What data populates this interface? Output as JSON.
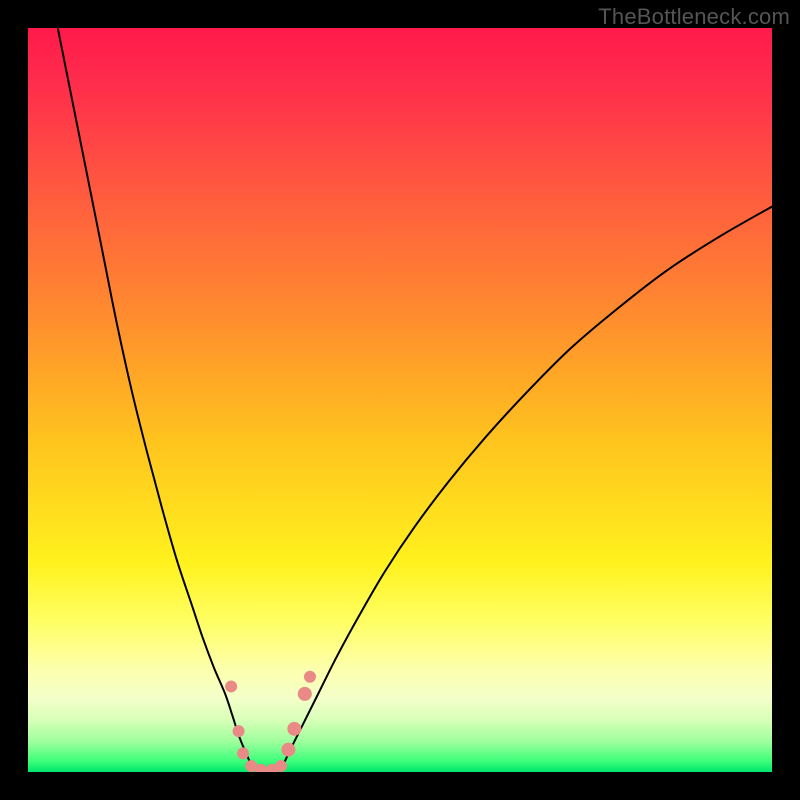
{
  "watermark": "TheBottleneck.com",
  "chart_data": {
    "type": "line",
    "title": "",
    "xlabel": "",
    "ylabel": "",
    "xlim": [
      0,
      100
    ],
    "ylim": [
      0,
      100
    ],
    "background_gradient": {
      "stops": [
        {
          "offset": 0.0,
          "color": "#ff1a4b"
        },
        {
          "offset": 0.08,
          "color": "#ff2e4b"
        },
        {
          "offset": 0.22,
          "color": "#ff5a3f"
        },
        {
          "offset": 0.38,
          "color": "#ff8a2f"
        },
        {
          "offset": 0.55,
          "color": "#ffc21e"
        },
        {
          "offset": 0.72,
          "color": "#fff21e"
        },
        {
          "offset": 0.8,
          "color": "#ffff66"
        },
        {
          "offset": 0.86,
          "color": "#fdffab"
        },
        {
          "offset": 0.9,
          "color": "#f4ffc9"
        },
        {
          "offset": 0.93,
          "color": "#d8ffb8"
        },
        {
          "offset": 0.96,
          "color": "#9cff9c"
        },
        {
          "offset": 0.985,
          "color": "#3eff7a"
        },
        {
          "offset": 1.0,
          "color": "#00e66b"
        }
      ]
    },
    "series": [
      {
        "name": "left-branch",
        "x": [
          4,
          6,
          8,
          10,
          12,
          14,
          16,
          18,
          20,
          22,
          23.5,
          25,
          26.5,
          27.5,
          28.3,
          29.1,
          29.8
        ],
        "y": [
          100,
          90,
          80,
          70,
          60,
          51,
          43,
          35.5,
          28.5,
          22.5,
          18,
          14,
          10.5,
          7.5,
          5,
          3,
          1.4
        ]
      },
      {
        "name": "right-branch",
        "x": [
          34.5,
          35.5,
          37,
          39,
          41.5,
          44.5,
          48,
          52,
          56.5,
          61.5,
          67,
          73,
          79.5,
          86,
          93,
          100
        ],
        "y": [
          1.4,
          3.5,
          6.5,
          10.5,
          15.5,
          21,
          27,
          33,
          39,
          45,
          51,
          57,
          62.5,
          67.5,
          72,
          76
        ]
      },
      {
        "name": "valley-floor",
        "x": [
          29.8,
          30.6,
          31.6,
          32.6,
          33.6,
          34.5
        ],
        "y": [
          1.4,
          0.6,
          0.3,
          0.3,
          0.6,
          1.4
        ]
      }
    ],
    "markers": {
      "name": "highlight-points",
      "color": "#e98a86",
      "points": [
        {
          "x": 27.3,
          "y": 11.5,
          "r": 6
        },
        {
          "x": 28.3,
          "y": 5.5,
          "r": 6
        },
        {
          "x": 28.9,
          "y": 2.5,
          "r": 6
        },
        {
          "x": 30.0,
          "y": 0.8,
          "r": 6
        },
        {
          "x": 31.3,
          "y": 0.3,
          "r": 6
        },
        {
          "x": 32.8,
          "y": 0.3,
          "r": 6
        },
        {
          "x": 34.0,
          "y": 0.8,
          "r": 6
        },
        {
          "x": 35.0,
          "y": 3.0,
          "r": 7
        },
        {
          "x": 35.8,
          "y": 5.8,
          "r": 7
        },
        {
          "x": 37.2,
          "y": 10.5,
          "r": 7
        },
        {
          "x": 37.9,
          "y": 12.8,
          "r": 6
        }
      ]
    }
  }
}
